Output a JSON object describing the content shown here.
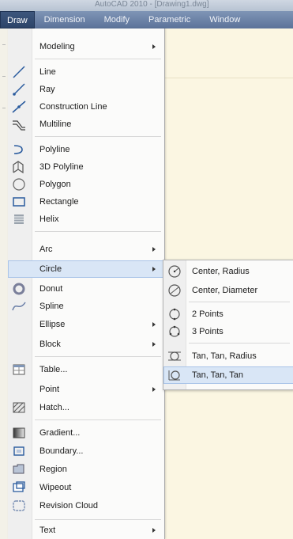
{
  "window": {
    "title": "AutoCAD 2010 - [Drawing1.dwg]"
  },
  "menubar": [
    "Draw",
    "Dimension",
    "Modify",
    "Parametric",
    "Window"
  ],
  "draw_menu": [
    {
      "label": "Modeling",
      "icon": "none",
      "submenu": true
    },
    {
      "label": "Line",
      "icon": "line-icon"
    },
    {
      "label": "Ray",
      "icon": "ray-icon"
    },
    {
      "label": "Construction Line",
      "icon": "construction-line-icon"
    },
    {
      "label": "Multiline",
      "icon": "multiline-icon"
    },
    {
      "label": "Polyline",
      "icon": "polyline-icon"
    },
    {
      "label": "3D Polyline",
      "icon": "3d-polyline-icon"
    },
    {
      "label": "Polygon",
      "icon": "polygon-icon"
    },
    {
      "label": "Rectangle",
      "icon": "rectangle-icon"
    },
    {
      "label": "Helix",
      "icon": "helix-icon"
    },
    {
      "label": "Arc",
      "icon": "none",
      "submenu": true
    },
    {
      "label": "Circle",
      "icon": "none",
      "submenu": true,
      "highlighted": true
    },
    {
      "label": "Donut",
      "icon": "donut-icon"
    },
    {
      "label": "Spline",
      "icon": "spline-icon"
    },
    {
      "label": "Ellipse",
      "icon": "none",
      "submenu": true
    },
    {
      "label": "Block",
      "icon": "none",
      "submenu": true
    },
    {
      "label": "Table...",
      "icon": "table-icon"
    },
    {
      "label": "Point",
      "icon": "none",
      "submenu": true
    },
    {
      "label": "Hatch...",
      "icon": "hatch-icon"
    },
    {
      "label": "Gradient...",
      "icon": "gradient-icon"
    },
    {
      "label": "Boundary...",
      "icon": "boundary-icon"
    },
    {
      "label": "Region",
      "icon": "region-icon"
    },
    {
      "label": "Wipeout",
      "icon": "wipeout-icon"
    },
    {
      "label": "Revision Cloud",
      "icon": "revision-cloud-icon"
    },
    {
      "label": "Text",
      "icon": "none",
      "submenu": true
    }
  ],
  "circle_submenu": [
    {
      "label": "Center, Radius",
      "icon": "center-radius-icon"
    },
    {
      "label": "Center, Diameter",
      "icon": "center-diameter-icon"
    },
    {
      "label": "2 Points",
      "icon": "2-points-icon"
    },
    {
      "label": "3 Points",
      "icon": "3-points-icon"
    },
    {
      "label": "Tan, Tan, Radius",
      "icon": "tan-tan-radius-icon"
    },
    {
      "label": "Tan, Tan, Tan",
      "icon": "tan-tan-tan-icon",
      "highlighted": true
    }
  ],
  "colors": {
    "menubar": "#5b7299",
    "menu_bg": "#fbfbfa",
    "highlight": "#d9e6f6",
    "canvas": "#fbf6e2"
  }
}
